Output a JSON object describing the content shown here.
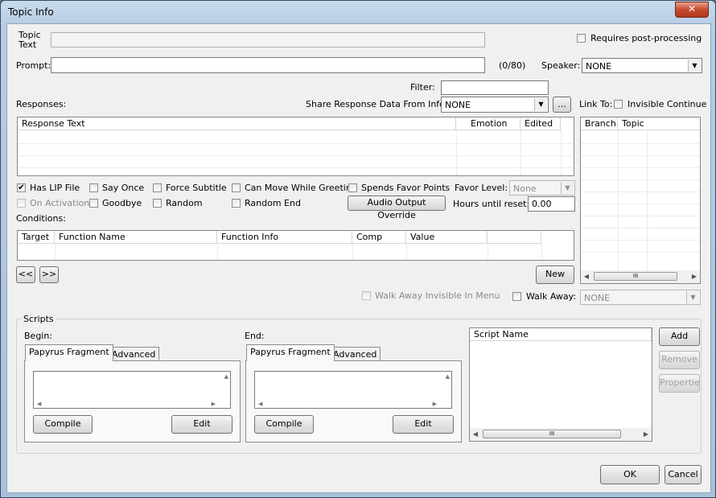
{
  "window": {
    "title": "Topic Info",
    "close": "✕"
  },
  "topic": {
    "label_line1": "Topic",
    "label_line2": "Text",
    "value": ""
  },
  "requires_post_processing": {
    "label": "Requires post-processing",
    "checked": false
  },
  "prompt": {
    "label": "Prompt:",
    "value": "",
    "counter": "(0/80)"
  },
  "speaker": {
    "label": "Speaker:",
    "value": "NONE"
  },
  "filter": {
    "label": "Filter:",
    "value": ""
  },
  "responses": {
    "label": "Responses:",
    "share_label": "Share Response Data From Info:",
    "share_value": "NONE",
    "share_button": "...",
    "columns": [
      "Response Text",
      "Emotion",
      "Edited"
    ]
  },
  "link_to": {
    "label": "Link To:",
    "invisible_continue": "Invisible Continue",
    "columns": [
      "Branch",
      "Topic"
    ],
    "scroll_thumb": "III"
  },
  "options": {
    "has_lip_file": "Has LIP File",
    "say_once": "Say Once",
    "force_subtitle": "Force Subtitle",
    "can_move_while_greeting": "Can Move While Greeting",
    "spends_favor_points": "Spends Favor Points",
    "favor_level_label": "Favor Level:",
    "favor_level_value": "None",
    "on_activation": "On Activation",
    "goodbye": "Goodbye",
    "random": "Random",
    "random_end": "Random End",
    "audio_output_override": "Audio Output Override",
    "hours_until_reset_label": "Hours until reset:",
    "hours_until_reset_value": "0.00"
  },
  "conditions": {
    "label": "Conditions:",
    "columns": [
      "Target",
      "Function Name",
      "Function Info",
      "Comp",
      "Value",
      ""
    ],
    "prev": "<<",
    "next": ">>",
    "new": "New"
  },
  "walk_away": {
    "invisible_in_menu": "Walk Away Invisible In Menu",
    "label": "Walk Away:",
    "value": "NONE"
  },
  "scripts": {
    "group_label": "Scripts",
    "begin_label": "Begin:",
    "end_label": "End:",
    "tab_fragment": "Papyrus Fragment",
    "tab_advanced": "Advanced",
    "compile": "Compile",
    "edit": "Edit",
    "script_name_header": "Script Name",
    "add": "Add",
    "remove": "Remove",
    "properties": "Propertie",
    "scroll_thumb": "III"
  },
  "footer": {
    "ok": "OK",
    "cancel": "Cancel"
  }
}
